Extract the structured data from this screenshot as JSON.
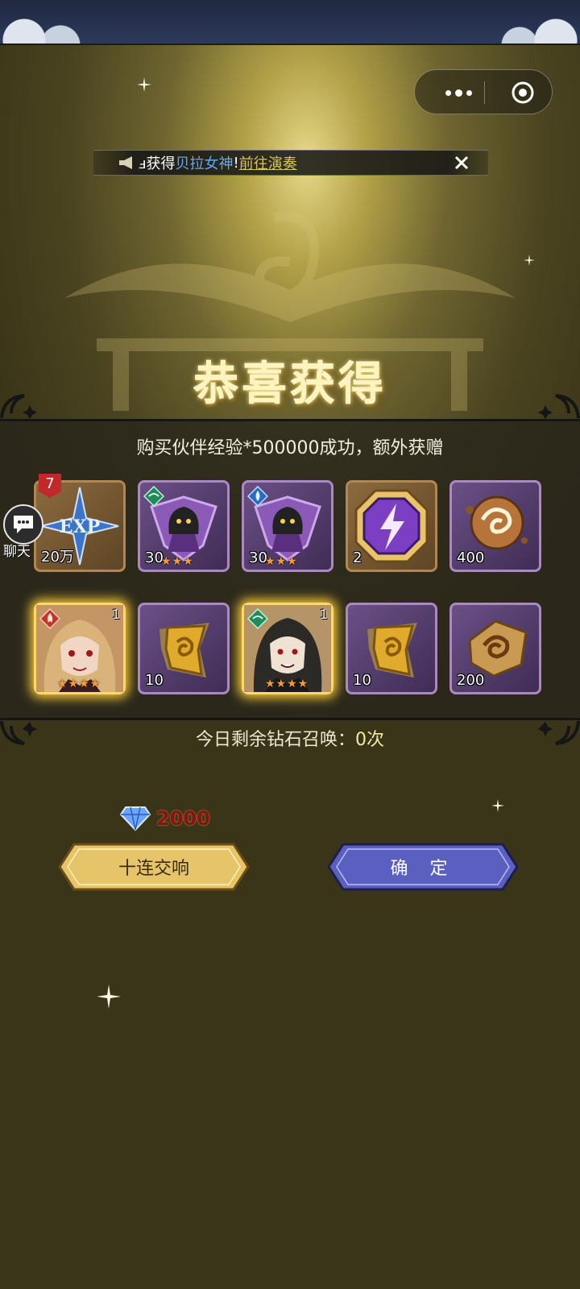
{
  "marquee": {
    "prefix": "ⅎ获得",
    "highlight": "贝拉女神",
    "bang": "!",
    "link": "前往演奏"
  },
  "title": "恭喜获得",
  "subtitle": "购买伙伴经验*500000成功，额外获赠",
  "red_flag_count": "7",
  "chat_label": "聊天",
  "rewards_row1": [
    {
      "icon": "exp-star-icon",
      "count": "20万",
      "stars": ""
    },
    {
      "icon": "hooded-hero-fragment-wind-icon",
      "count": "30",
      "stars": "★★★"
    },
    {
      "icon": "hooded-hero-fragment-water-icon",
      "count": "30",
      "stars": "★★★"
    },
    {
      "icon": "lightning-octagon-icon",
      "count": "2",
      "stars": ""
    },
    {
      "icon": "swirl-orb-icon",
      "count": "400",
      "stars": ""
    }
  ],
  "rewards_row2": [
    {
      "icon": "blonde-heroine-portrait",
      "count": "",
      "level": "1",
      "stars": "★★★★"
    },
    {
      "icon": "gold-rune-stone-icon",
      "count": "10",
      "stars": ""
    },
    {
      "icon": "dark-haired-hero-portrait",
      "count": "",
      "level": "1",
      "stars": "★★★★"
    },
    {
      "icon": "gold-rune-stone-icon",
      "count": "10",
      "stars": ""
    },
    {
      "icon": "spiral-ore-icon",
      "count": "200",
      "stars": ""
    }
  ],
  "summon": {
    "label": "今日剩余钻石召唤：",
    "value": "0次"
  },
  "cost": {
    "icon": "diamond-icon",
    "amount": "2000"
  },
  "buttons": {
    "ten_pull": "十连交响",
    "confirm": "确 定"
  },
  "colors": {
    "gold_accent": "#ffd86a",
    "link_blue": "#5fa8ff",
    "cost_red": "#8b1010",
    "confirm_button": "#5b5fc0"
  }
}
